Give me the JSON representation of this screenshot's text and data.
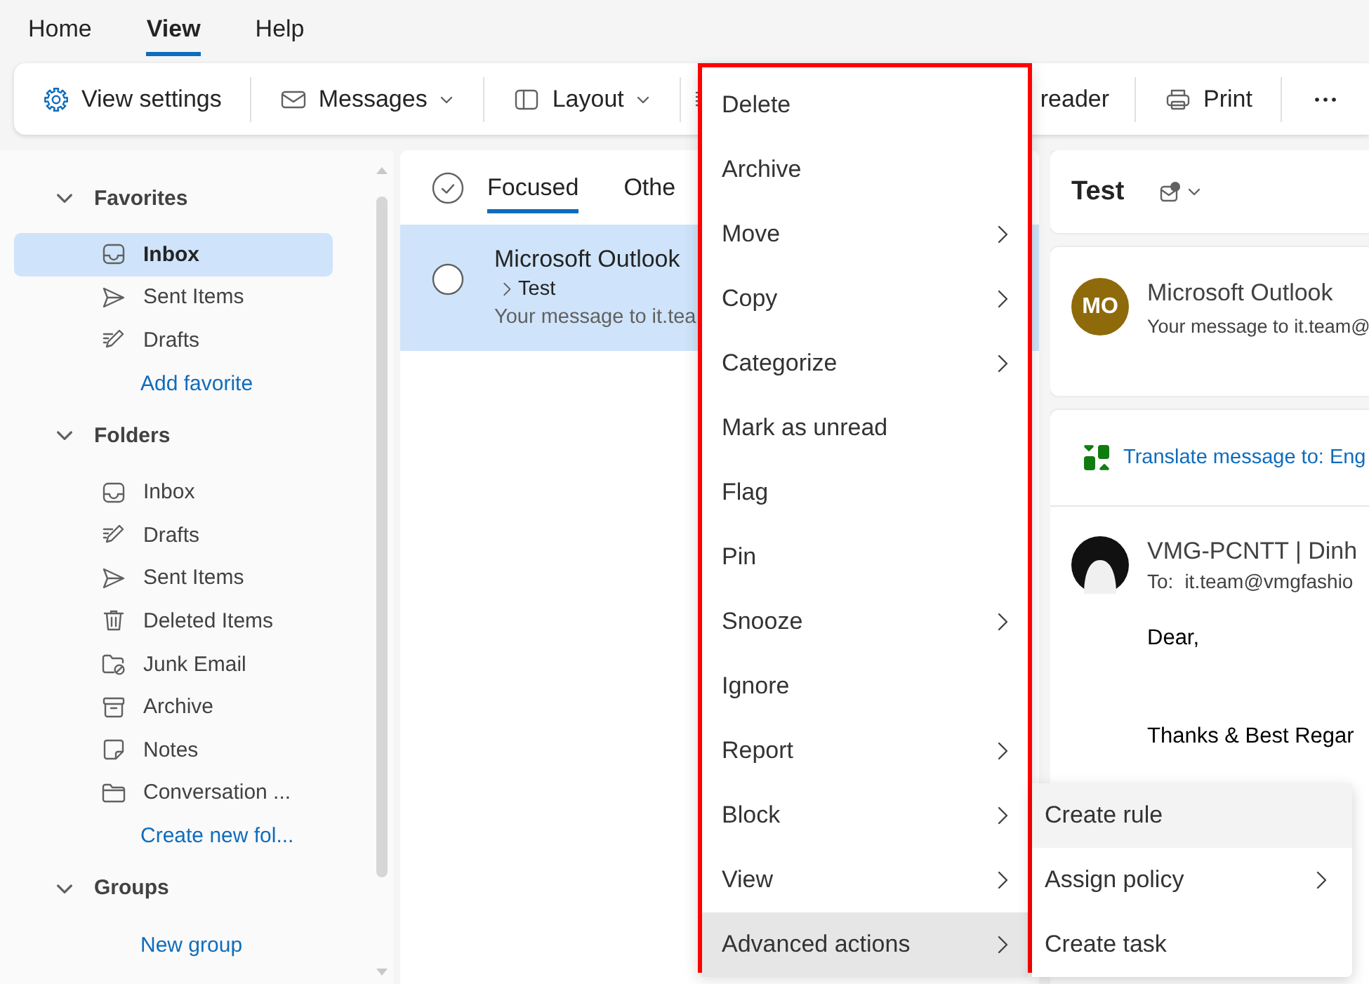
{
  "top_tabs": [
    {
      "label": "Home",
      "selected": false
    },
    {
      "label": "View",
      "selected": true
    },
    {
      "label": "Help",
      "selected": false
    }
  ],
  "ribbon": {
    "items": [
      {
        "kind": "button",
        "label": "View settings",
        "dropdown": false
      },
      {
        "kind": "button",
        "label": "Messages",
        "dropdown": true
      },
      {
        "kind": "button",
        "label": "Layout",
        "dropdown": true
      },
      {
        "kind": "icon"
      },
      {
        "kind": "button",
        "label": "reader",
        "dropdown": false
      },
      {
        "kind": "button",
        "label": "Print",
        "dropdown": false
      },
      {
        "kind": "more"
      }
    ]
  },
  "sidebar": {
    "sections": [
      {
        "title": "Favorites",
        "expanded": true,
        "items": [
          {
            "kind": "inbox",
            "label": "Inbox",
            "selected": true
          },
          {
            "kind": "sent",
            "label": "Sent Items",
            "selected": false
          },
          {
            "kind": "drafts",
            "label": "Drafts",
            "selected": false
          },
          {
            "kind": "link",
            "label": "Add favorite",
            "selected": false
          }
        ]
      },
      {
        "title": "Folders",
        "expanded": true,
        "items": [
          {
            "kind": "inbox",
            "label": "Inbox",
            "selected": false
          },
          {
            "kind": "drafts",
            "label": "Drafts",
            "selected": false
          },
          {
            "kind": "sent",
            "label": "Sent Items",
            "selected": false
          },
          {
            "kind": "deleted",
            "label": "Deleted Items",
            "selected": false
          },
          {
            "kind": "junk",
            "label": "Junk Email",
            "selected": false
          },
          {
            "kind": "archive",
            "label": "Archive",
            "selected": false
          },
          {
            "kind": "notes",
            "label": "Notes",
            "selected": false
          },
          {
            "kind": "folder",
            "label": "Conversation ...",
            "selected": false
          },
          {
            "kind": "link",
            "label": "Create new fol...",
            "selected": false
          }
        ]
      },
      {
        "title": "Groups",
        "expanded": true,
        "items": [
          {
            "kind": "link",
            "label": "New group",
            "selected": false
          }
        ]
      }
    ]
  },
  "message_list": {
    "tabs": [
      {
        "label": "Focused",
        "selected": true
      },
      {
        "label": "Othe",
        "selected": false
      }
    ],
    "messages": [
      {
        "sender": "Microsoft Outlook",
        "subject": "Test",
        "preview": "Your message to it.tea",
        "selected": true
      }
    ]
  },
  "reading_pane": {
    "subject": "Test",
    "summary": {
      "initials": "MO",
      "sender": "Microsoft Outlook",
      "preview": "Your message to it.team@"
    },
    "translate": "Translate message to: Eng",
    "email": {
      "sender": "VMG-PCNTT | Dinh",
      "to_label": "To:",
      "to": "it.team@vmgfashio",
      "body": [
        "Dear,",
        "Thanks & Best Regar"
      ]
    }
  },
  "context_menu": {
    "items": [
      {
        "label": "Delete",
        "submenu": false,
        "selected": false
      },
      {
        "label": "Archive",
        "submenu": false,
        "selected": false
      },
      {
        "label": "Move",
        "submenu": true,
        "selected": false
      },
      {
        "label": "Copy",
        "submenu": true,
        "selected": false
      },
      {
        "label": "Categorize",
        "submenu": true,
        "selected": false
      },
      {
        "label": "Mark as unread",
        "submenu": false,
        "selected": false
      },
      {
        "label": "Flag",
        "submenu": false,
        "selected": false
      },
      {
        "label": "Pin",
        "submenu": false,
        "selected": false
      },
      {
        "label": "Snooze",
        "submenu": true,
        "selected": false
      },
      {
        "label": "Ignore",
        "submenu": false,
        "selected": false
      },
      {
        "label": "Report",
        "submenu": true,
        "selected": false
      },
      {
        "label": "Block",
        "submenu": true,
        "selected": false
      },
      {
        "label": "View",
        "submenu": true,
        "selected": false
      },
      {
        "label": "Advanced actions",
        "submenu": true,
        "selected": true
      }
    ],
    "submenu_items": [
      {
        "label": "Create rule",
        "submenu": false,
        "selected": true
      },
      {
        "label": "Assign policy",
        "submenu": true,
        "selected": false
      },
      {
        "label": "Create task",
        "submenu": false,
        "selected": false
      }
    ]
  }
}
